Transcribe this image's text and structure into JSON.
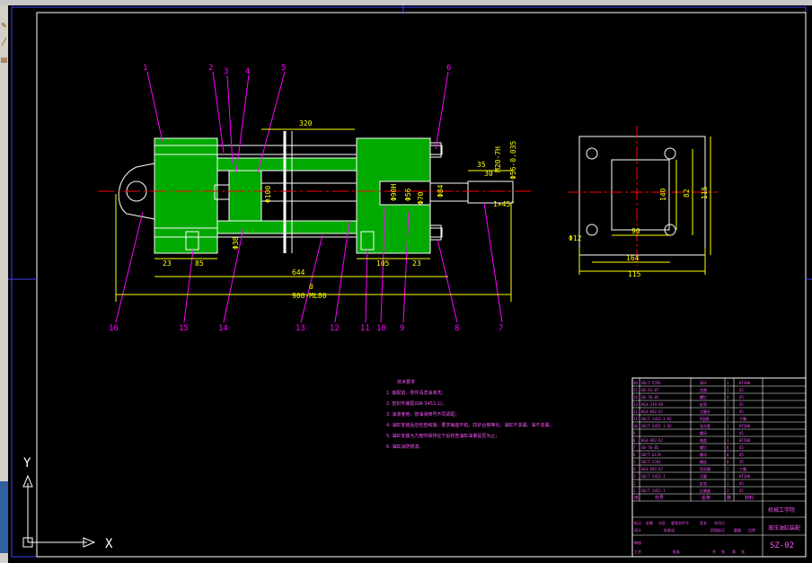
{
  "app": {
    "toolbar_icons": [
      "pencil-icon",
      "line-icon",
      "hatch-icon"
    ],
    "accent_colors": {
      "background": "#000000",
      "outline": "#ffffff",
      "dimension": "#ffff00",
      "leader": "#ff00ff",
      "hatch": "#00aa00",
      "centerline": "#ff0000",
      "frame": "#4040ff"
    }
  },
  "drawing": {
    "part_labels": [
      "1",
      "2",
      "3",
      "4",
      "5",
      "6",
      "16",
      "15",
      "14",
      "13",
      "12",
      "11",
      "10",
      "9",
      "8",
      "7"
    ],
    "dims": {
      "d320": "320",
      "d35": "35",
      "d30": "30",
      "dM20": "M20-7H",
      "dphi56": "Φ56-0.035",
      "dphi100": "Φ100",
      "dphi38": "Φ38",
      "dphi90": "Φ90H",
      "dphi56b": "Φ56",
      "dphi70": "Φ70",
      "dphi84": "Φ84",
      "d1x45": "1×45°",
      "d23a": "23",
      "d85": "85",
      "d105": "105",
      "d23b": "23",
      "d644": "644",
      "d900": "900-ML80",
      "d0": "0"
    }
  },
  "side_view": {
    "dims": {
      "d140": "140",
      "d82": "82",
      "d115v": "115",
      "d90": "90",
      "d12": "Φ12",
      "d164": "164",
      "d115h": "115"
    }
  },
  "notes": {
    "title": "技术要求",
    "lines": [
      "1. 装配前，零件清洗油液洗；",
      "2. 密封件装配(GB-3452.1)；",
      "3. 油液使用，按油液牌号不同调配；",
      "4. 油缸安装后应检查和接，要求每座平稳，防护合格等化，油缸不渗漏，油不渗漏；",
      "5. 油缸安装为力度时保持在下后检查油缸油量是否为止；",
      "6. 油缸涂防锈漆。"
    ]
  },
  "title_block": {
    "company": "机械工学院",
    "drawing_name": "液压油缸装配",
    "drawing_no": "SZ-02",
    "bom_rows": [
      [
        "16",
        "GB/T-5783",
        "耳环",
        "1",
        "HT200"
      ],
      [
        "15",
        "GB-93-87",
        "垫圈",
        "1",
        "45"
      ],
      [
        "14",
        "GB-70-85",
        "螺钉",
        "4",
        "45"
      ],
      [
        "13",
        "HG4-339-69",
        "缸筒",
        "1",
        "45"
      ],
      [
        "12",
        "HG4-692-67",
        "活塞杆",
        "1",
        "45"
      ],
      [
        "11",
        "GB/T 3452.1-92",
        "O型圈",
        "2",
        "丁腈"
      ],
      [
        "10",
        "GB/T 3452.1-92",
        "导向套",
        "1",
        "HT200"
      ],
      [
        "9",
        "",
        "螺母",
        "1",
        "45"
      ],
      [
        "8",
        "HG4-692-67",
        "端盖",
        "1",
        "HT200"
      ],
      [
        "7",
        "GB-70-85",
        "螺钉",
        "8",
        "45"
      ],
      [
        "6",
        "GB/T 6170",
        "螺母",
        "8",
        "45"
      ],
      [
        "5",
        "GB/T-5783",
        "螺栓",
        "8",
        "35"
      ],
      [
        "4",
        "HG4-692-67",
        "密封圈",
        "2",
        "丁腈"
      ],
      [
        "3",
        "GB/T 3452.1",
        "活塞",
        "1",
        "HT200"
      ],
      [
        "2",
        "",
        "缸底",
        "1",
        "45"
      ],
      [
        "1",
        "GB/T 3452.1",
        "后端盖",
        "1",
        "45"
      ]
    ],
    "header_cells": [
      "序",
      "代号",
      "名称",
      "数",
      "材料"
    ],
    "sign_cells": [
      "标记",
      "处数",
      "分区",
      "更改文件号",
      "签名",
      "年月日"
    ],
    "sign_cells2": [
      "设计",
      "标准化",
      "阶段标记",
      "重量",
      "比例"
    ],
    "sign_cells3": [
      "审核",
      "工艺",
      "批准",
      "共",
      "张",
      "第",
      "张"
    ]
  },
  "ucs": {
    "y_label": "Y",
    "x_label": "X"
  }
}
